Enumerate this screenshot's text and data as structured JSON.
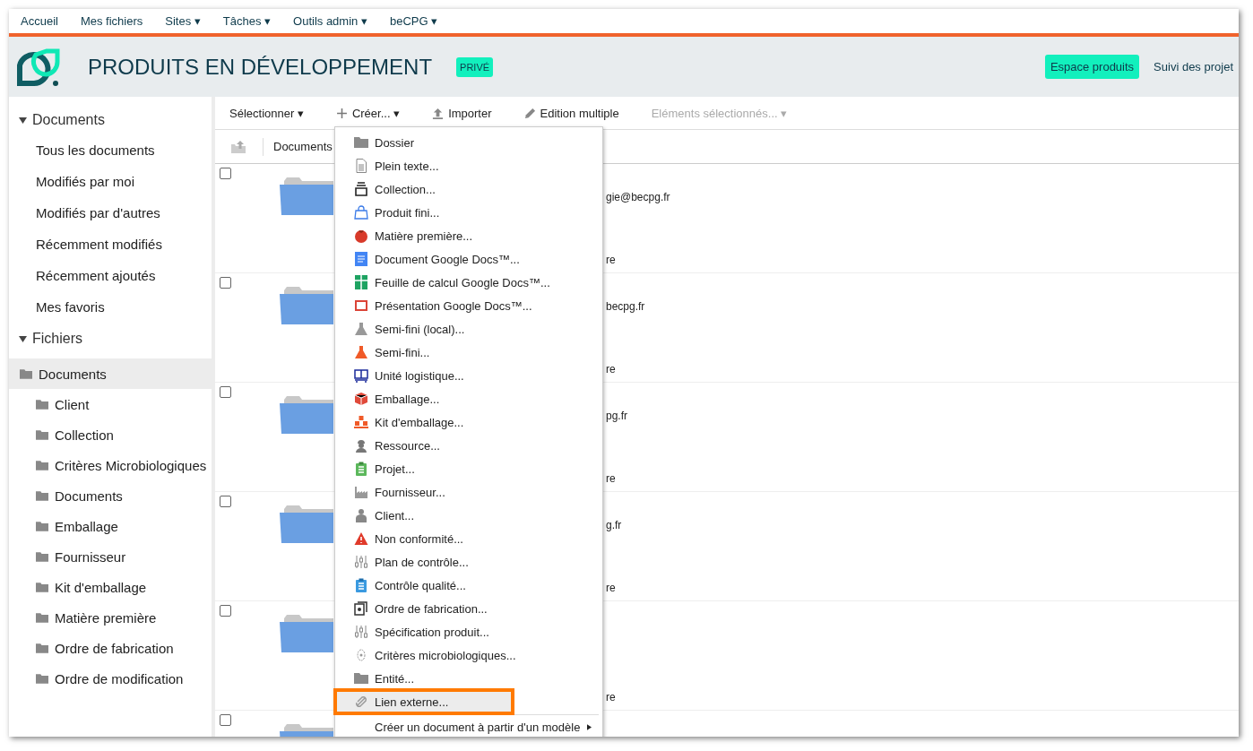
{
  "top_nav": [
    {
      "label": "Accueil"
    },
    {
      "label": "Mes fichiers"
    },
    {
      "label": "Sites ▾"
    },
    {
      "label": "Tâches ▾"
    },
    {
      "label": "Outils admin ▾"
    },
    {
      "label": "beCPG ▾"
    }
  ],
  "header": {
    "title": "PRODUITS EN DÉVELOPPEMENT",
    "badge": "PRIVÉ",
    "links": [
      {
        "label": "Espace produits",
        "selected": true
      },
      {
        "label": "Suivi des projet",
        "selected": false
      }
    ]
  },
  "sidebar": {
    "sections": [
      {
        "title": "Documents",
        "expanded": true,
        "kind": "list",
        "items": [
          "Tous les documents",
          "Modifiés par moi",
          "Modifiés par d'autres",
          "Récemment modifiés",
          "Récemment ajoutés",
          "Mes favoris"
        ]
      },
      {
        "title": "Fichiers",
        "expanded": true,
        "kind": "tree",
        "tree": [
          {
            "label": "Documents",
            "selected": true,
            "children": [
              {
                "label": "Client",
                "selected": false
              },
              {
                "label": "Collection",
                "selected": false
              },
              {
                "label": "Critères Microbiologiques",
                "selected": false
              },
              {
                "label": "Documents",
                "selected": false
              },
              {
                "label": "Emballage",
                "selected": false
              },
              {
                "label": "Fournisseur",
                "selected": false
              },
              {
                "label": "Kit d'emballage",
                "selected": false
              },
              {
                "label": "Matière première",
                "selected": false
              },
              {
                "label": "Ordre de fabrication",
                "selected": false
              },
              {
                "label": "Ordre de modification",
                "selected": false
              }
            ]
          }
        ]
      }
    ]
  },
  "toolbar": [
    {
      "label": "Sélectionner ▾",
      "kind": "plain",
      "disabled": false
    },
    {
      "label": "Créer... ▾",
      "kind": "create",
      "disabled": false
    },
    {
      "label": "Importer",
      "kind": "upload",
      "disabled": false
    },
    {
      "label": "Edition multiple",
      "kind": "pencil",
      "disabled": false
    },
    {
      "label": "Eléments sélectionnés... ▾",
      "kind": "plain",
      "disabled": true
    }
  ],
  "breadcrumb": {
    "label": "Documents"
  },
  "rows": [
    {
      "checked": false,
      "line_1": "gie@becpg.fr",
      "line_2": "re"
    },
    {
      "checked": false,
      "line_1": "becpg.fr",
      "line_2": "re"
    },
    {
      "checked": false,
      "line_1": "pg.fr",
      "line_2": "re"
    },
    {
      "checked": false,
      "line_1": "g.fr",
      "line_2": "re"
    },
    {
      "checked": false,
      "line_2": "re"
    },
    {
      "checked": false
    }
  ],
  "create_menu": {
    "items": [
      {
        "label": "Dossier",
        "kind": "folder",
        "selected": false
      },
      {
        "label": "Plein texte...",
        "kind": "text",
        "selected": false
      },
      {
        "label": "Collection...",
        "kind": "collection",
        "selected": false
      },
      {
        "label": "Produit fini...",
        "kind": "bag",
        "selected": false
      },
      {
        "label": "Matière première...",
        "kind": "tomato",
        "selected": false
      },
      {
        "label": "Document Google Docs™...",
        "kind": "gdoc",
        "selected": false
      },
      {
        "label": "Feuille de calcul Google Docs™...",
        "kind": "gsheet",
        "selected": false
      },
      {
        "label": "Présentation Google Docs™...",
        "kind": "gslide",
        "selected": false
      },
      {
        "label": "Semi-fini (local)...",
        "kind": "flask_grey",
        "selected": false
      },
      {
        "label": "Semi-fini...",
        "kind": "flask_orange",
        "selected": false
      },
      {
        "label": "Unité logistique...",
        "kind": "pallet",
        "selected": false
      },
      {
        "label": "Emballage...",
        "kind": "box",
        "selected": false
      },
      {
        "label": "Kit d'emballage...",
        "kind": "boxes",
        "selected": false
      },
      {
        "label": "Ressource...",
        "kind": "worker",
        "selected": false
      },
      {
        "label": "Projet...",
        "kind": "clip_green",
        "selected": false
      },
      {
        "label": "Fournisseur...",
        "kind": "factory",
        "selected": false
      },
      {
        "label": "Client...",
        "kind": "person",
        "selected": false
      },
      {
        "label": "Non conformité...",
        "kind": "warning",
        "selected": false
      },
      {
        "label": "Plan de contrôle...",
        "kind": "sliders",
        "selected": false
      },
      {
        "label": "Contrôle qualité...",
        "kind": "clip_blue",
        "selected": false
      },
      {
        "label": "Ordre de fabrication...",
        "kind": "stack",
        "selected": false
      },
      {
        "label": "Spécification produit...",
        "kind": "sliders",
        "selected": false
      },
      {
        "label": "Critères microbiologiques...",
        "kind": "microbe",
        "selected": false
      },
      {
        "label": "Entité...",
        "kind": "folder",
        "selected": false
      },
      {
        "label": "Lien externe...",
        "kind": "link",
        "selected": true
      },
      {
        "label": "Créer un document à partir d'un modèle",
        "kind": "submenu",
        "submenu": true,
        "selected": false
      }
    ]
  }
}
